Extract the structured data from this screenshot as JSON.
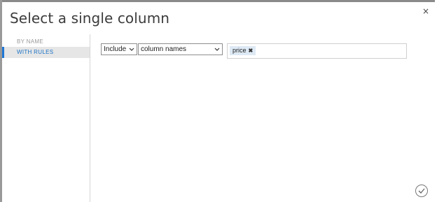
{
  "dialog": {
    "title": "Select a single column",
    "close_label": "×"
  },
  "sidebar": {
    "items": [
      {
        "label": "BY NAME",
        "selected": false
      },
      {
        "label": "WITH RULES",
        "selected": true
      }
    ]
  },
  "rule": {
    "mode": "Include",
    "mode_icon": "chevron-down-icon",
    "target": "column names",
    "target_icon": "chevron-down-icon",
    "tags": [
      {
        "label": "price",
        "remove_label": "✖"
      }
    ]
  },
  "footer": {
    "ok_icon": "checkmark-icon"
  },
  "colors": {
    "accent": "#1c73c6",
    "selected_bg": "#e6e6e6",
    "tag_bg": "#dde9f4"
  }
}
